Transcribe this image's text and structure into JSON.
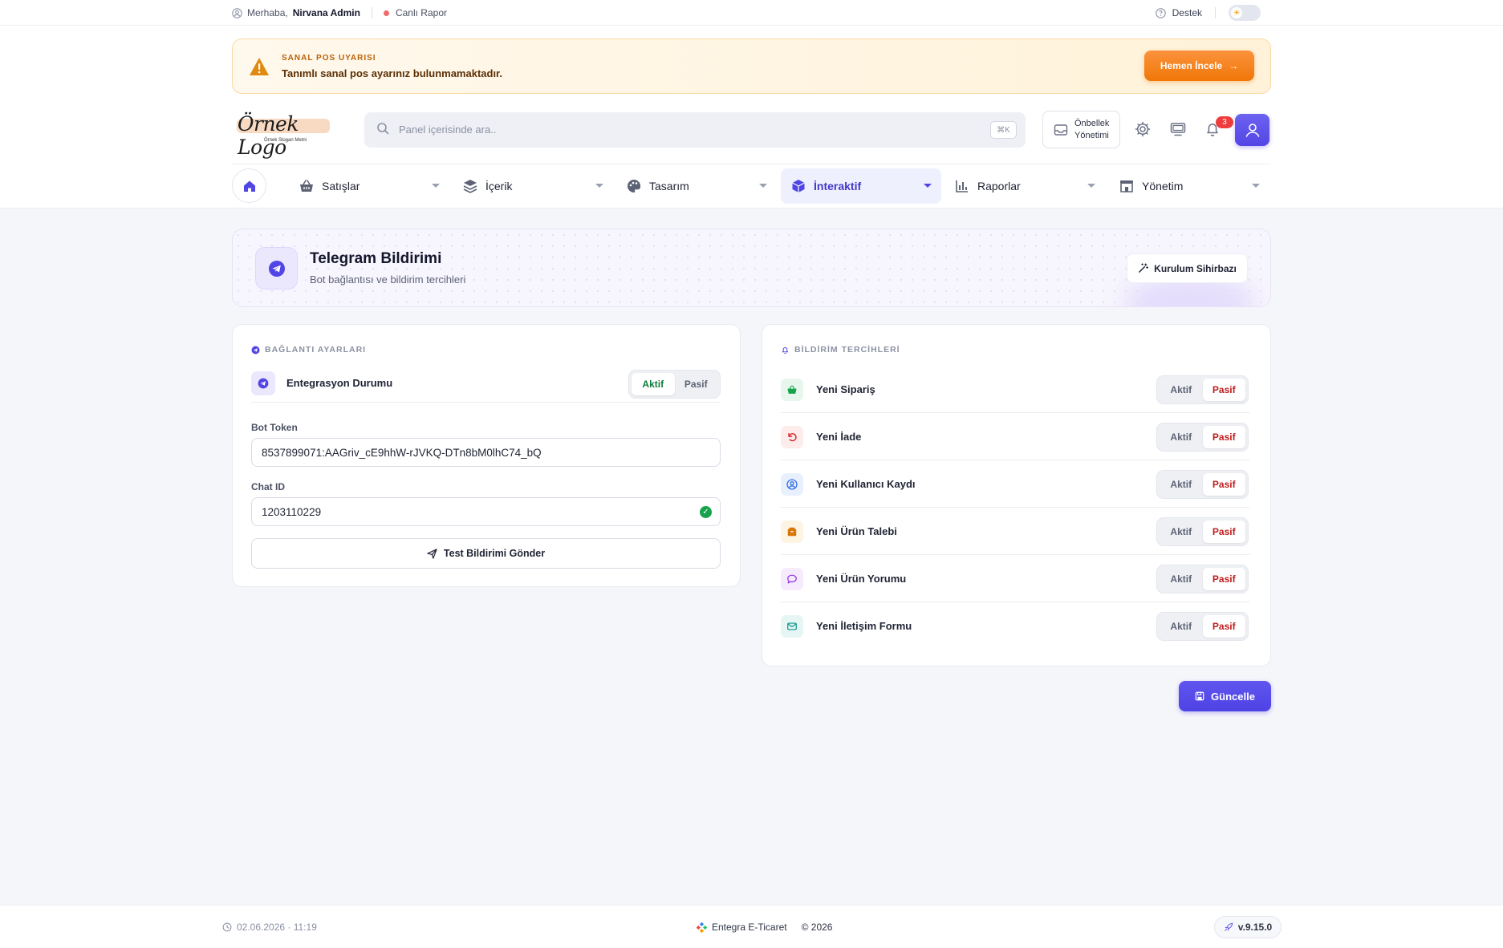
{
  "topbar": {
    "greeting": "Merhaba,",
    "user_name": "Nirvana Admin",
    "live_report": "Canlı Rapor",
    "support": "Destek"
  },
  "alert": {
    "kicker": "SANAL POS UYARISI",
    "message": "Tanımlı sanal pos ayarınız bulunmamaktadır.",
    "button": "Hemen İncele"
  },
  "logo": {
    "title": "Örnek Logo",
    "slogan": "Örnek Slogan Metni"
  },
  "search": {
    "placeholder": "Panel içerisinde ara..",
    "shortcut": "⌘K"
  },
  "header_actions": {
    "cache_line1": "Önbellek",
    "cache_line2": "Yönetimi",
    "notification_count": "3"
  },
  "nav": {
    "items": [
      {
        "label": "Satışlar",
        "icon": "basket-icon"
      },
      {
        "label": "İçerik",
        "icon": "layers-icon"
      },
      {
        "label": "Tasarım",
        "icon": "palette-icon"
      },
      {
        "label": "İnteraktif",
        "icon": "cube-icon",
        "active": true
      },
      {
        "label": "Raporlar",
        "icon": "bar-chart-icon"
      },
      {
        "label": "Yönetim",
        "icon": "store-icon"
      }
    ]
  },
  "page": {
    "title": "Telegram Bildirimi",
    "subtitle": "Bot bağlantısı ve bildirim tercihleri",
    "wizard_button": "Kurulum Sihirbazı"
  },
  "connection": {
    "section_title": "BAĞLANTI AYARLARI",
    "integration_label": "Entegrasyon Durumu",
    "integration_state": "Aktif",
    "active_label": "Aktif",
    "passive_label": "Pasif",
    "bot_token_label": "Bot Token",
    "bot_token_value": "8537899071:AAGriv_cE9hhW-rJVKQ-DTn8bM0lhC74_bQ",
    "chat_id_label": "Chat ID",
    "chat_id_value": "1203110229",
    "test_button": "Test Bildirimi Gönder"
  },
  "preferences": {
    "section_title": "BİLDİRİM TERCİHLERİ",
    "active_label": "Aktif",
    "passive_label": "Pasif",
    "items": [
      {
        "label": "Yeni Sipariş",
        "state": "Pasif",
        "icon": "basket-icon",
        "color": "#16a34a",
        "bg": "#e8f7ee"
      },
      {
        "label": "Yeni İade",
        "state": "Pasif",
        "icon": "undo-icon",
        "color": "#dc2626",
        "bg": "#fdecec"
      },
      {
        "label": "Yeni Kullanıcı Kaydı",
        "state": "Pasif",
        "icon": "user-circle-icon",
        "color": "#2563eb",
        "bg": "#e8effd"
      },
      {
        "label": "Yeni Ürün Talebi",
        "state": "Pasif",
        "icon": "box-icon",
        "color": "#d97706",
        "bg": "#fdf4e3"
      },
      {
        "label": "Yeni Ürün Yorumu",
        "state": "Pasif",
        "icon": "chat-icon",
        "color": "#9333ea",
        "bg": "#f5ebfd"
      },
      {
        "label": "Yeni İletişim Formu",
        "state": "Pasif",
        "icon": "mail-icon",
        "color": "#0d9488",
        "bg": "#e5f6f4"
      }
    ]
  },
  "update_button": "Güncelle",
  "footer": {
    "datetime": "02.06.2026 · 11:19",
    "brand": "Entegra E-Ticaret",
    "copyright": "© 2026",
    "version": "v.9.15.0"
  },
  "colors": {
    "accent": "#4f46e5",
    "alert_orange": "#f07708",
    "active_green": "#0f7a3a",
    "passive_red": "#c01c1c"
  }
}
